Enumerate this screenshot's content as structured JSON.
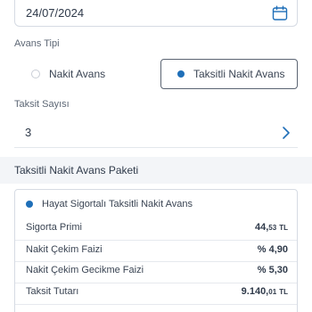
{
  "date_field": {
    "value": "24/07/2024",
    "icon": "calendar-icon"
  },
  "advance_type": {
    "label": "Avans Tipi",
    "options": [
      {
        "label": "Nakit Avans",
        "selected": false
      },
      {
        "label": "Taksitli Nakit Avans",
        "selected": true
      }
    ]
  },
  "installment": {
    "label": "Taksit Sayısı",
    "value": "3",
    "icon": "chevron-right-icon"
  },
  "package": {
    "header": "Taksitli Nakit Avans Paketi",
    "card_title": "Hayat Sigortalı Taksitli Nakit Avans",
    "rows": [
      {
        "label": "Sigorta Primi",
        "value_main": "44,",
        "value_dec": "53",
        "value_cur": "TL"
      },
      {
        "label": "Nakit Çekim Faizi",
        "value": "% 4,90"
      },
      {
        "label": "Nakit Çekim Gecikme Faizi",
        "value": "% 5,30"
      },
      {
        "label": "Taksit Tutarı",
        "value_main": "9.140,",
        "value_dec": "01",
        "value_cur": "TL"
      }
    ]
  },
  "colors": {
    "accent": "#1f6fb8",
    "border": "#d6dbe3",
    "header_bg": "#f3f5f8"
  }
}
